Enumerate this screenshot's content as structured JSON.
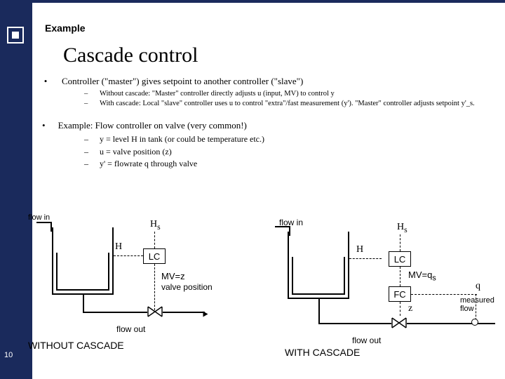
{
  "page_number": "10",
  "header_label": "Example",
  "title": "Cascade control",
  "bullet1": "Controller (\"master\") gives setpoint to another controller (\"slave\")",
  "bullet1_sub1": "Without cascade: \"Master\" controller directly adjusts u (input, MV) to control y",
  "bullet1_sub2": "With cascade: Local \"slave\" controller uses u to control \"extra\"/fast measurement (y'). \"Master\" controller adjusts setpoint y'_s.",
  "bullet2": "Example: Flow controller on valve (very common!)",
  "bullet2_sub1": "y = level H in tank (or could be temperature etc.)",
  "bullet2_sub2": "u = valve position (z)",
  "bullet2_sub3": "y' = flowrate q through valve",
  "diagram_left": {
    "flow_in": "flow in",
    "H": "H",
    "Hs": "H_s",
    "LC": "LC",
    "MV": "MV=z",
    "valve_pos": "valve position",
    "flow_out": "flow out",
    "caption": "WITHOUT CASCADE"
  },
  "diagram_right": {
    "flow_in": "flow in",
    "H": "H",
    "Hs": "H_s",
    "LC": "LC",
    "MVqs": "MV=q_s",
    "FC": "FC",
    "z": "z",
    "q": "q",
    "measured": "measured flow",
    "flow_out": "flow out",
    "caption": "WITH CASCADE"
  }
}
